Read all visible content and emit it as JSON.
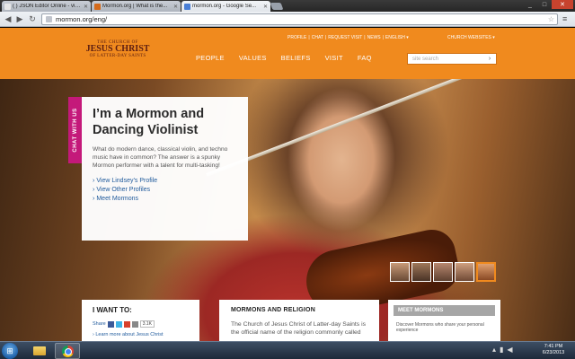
{
  "browser": {
    "tabs": [
      {
        "label": "( ) JSON Editor Online - view...",
        "favicon_color": "#e8e8e8",
        "active": false
      },
      {
        "label": "Mormon.org | What is the...",
        "favicon_color": "#d46a1a",
        "active": false
      },
      {
        "label": "mormon.org - Google Se...",
        "favicon_color": "#4a7fd6",
        "active": true
      }
    ],
    "address": "mormon.org/eng/",
    "window_controls": {
      "minimize": "_",
      "maximize": "□",
      "close": "✕"
    }
  },
  "site": {
    "logo": {
      "line1": "THE CHURCH OF",
      "line2": "JESUS CHRIST",
      "line3": "OF LATTER-DAY SAINTS"
    },
    "utility_links": [
      "PROFILE",
      "CHAT",
      "REQUEST VISIT",
      "NEWS",
      "ENGLISH ▾"
    ],
    "church_websites": "CHURCH WEBSITES ▾",
    "nav": [
      "PEOPLE",
      "VALUES",
      "BELIEFS",
      "VISIT",
      "FAQ"
    ],
    "search_placeholder": "site search",
    "brand_color": "#f08a1e"
  },
  "hero": {
    "chat_tab": "CHAT WITH US",
    "title": "I’m a Mormon and Dancing Violinist",
    "description": "What do modern dance, classical violin, and techno music have in common? The answer is a spunky Mormon performer with a talent for multi-tasking!",
    "links": [
      "View Lindsey’s Profile",
      "View Other Profiles",
      "Meet Mormons"
    ]
  },
  "panels": {
    "iwant": {
      "title": "I WANT TO:",
      "share_label": "Share",
      "share_count": "3.1K",
      "learn_link": "Learn more about Jesus Christ"
    },
    "religion": {
      "title": "MORMONS AND RELIGION",
      "text": "The Church of Jesus Christ of Latter-day Saints is the official name of the religion commonly called"
    },
    "meet": {
      "title": "MEET MORMONS",
      "text": "Discover Mormons who share your personal experience"
    }
  },
  "taskbar": {
    "time": "7:41 PM",
    "date": "6/23/2013"
  }
}
